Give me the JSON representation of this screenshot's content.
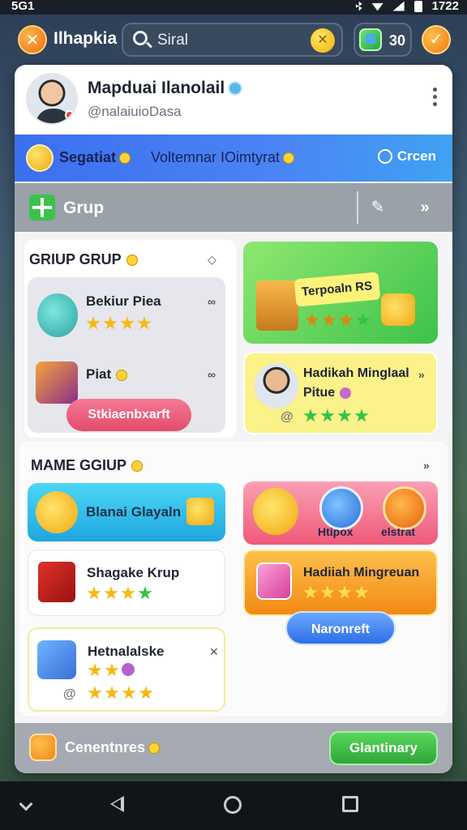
{
  "status": {
    "left": "5G1",
    "right": "1722"
  },
  "app": {
    "title": "Ilhapkia",
    "search_text": "Siral",
    "coins": "30"
  },
  "profile": {
    "name": "Mapduai Ilanolail",
    "handle": "@nalaiuioDasa"
  },
  "banner": {
    "title": "Segatiat",
    "subtitle": "Voltemnar IOimtyrat",
    "button": "Crcen"
  },
  "groupbar": {
    "label": "Grup"
  },
  "section1": {
    "title": "GRIUP GRUP",
    "items": [
      {
        "label": "Bekiur Piea",
        "stars": 4
      },
      {
        "label": "Piat"
      }
    ],
    "pill": "Stkiaenbxarft",
    "promo": {
      "label": "Terpoaln RS",
      "stars": 4
    },
    "featured": {
      "label_line1": "Hadikah Minglaal",
      "label_line2": "Pitue",
      "stars": 4
    }
  },
  "section2": {
    "title": "MAME GGIUP",
    "items": [
      {
        "label": "Blanai Glayaln"
      },
      {
        "label": "Shagake Krup",
        "stars": 4
      },
      {
        "label": "Hetnalalske",
        "stars": 3
      }
    ],
    "icons": {
      "a": "Htipox",
      "b": "elstrat"
    },
    "reward": {
      "label": "Hadiiah Mingreuan",
      "stars": 4
    },
    "pill": "Naronreft"
  },
  "footer": {
    "label": "Cenentnres",
    "button": "Glantinary"
  },
  "colors": {
    "accent_blue": "#3b6ff0",
    "green": "#3cc24a",
    "orange": "#f07a10",
    "pink": "#ef5a78"
  }
}
